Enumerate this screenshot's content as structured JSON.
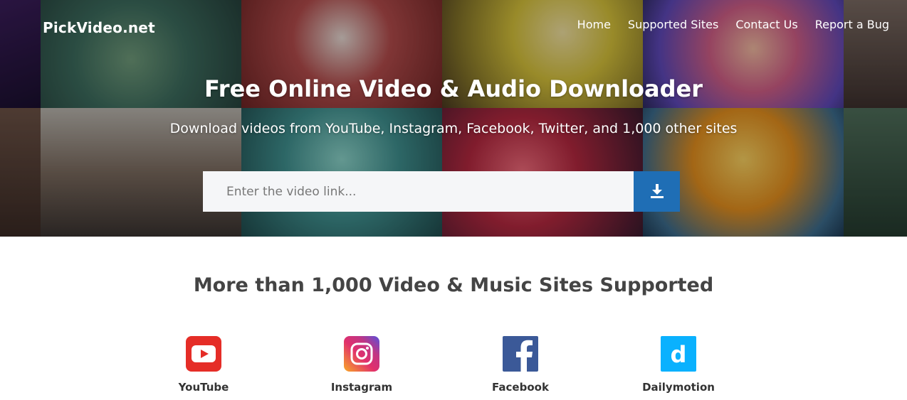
{
  "brand": "PickVideo.net",
  "nav": [
    {
      "label": "Home"
    },
    {
      "label": "Supported Sites"
    },
    {
      "label": "Contact Us"
    },
    {
      "label": "Report a Bug"
    }
  ],
  "hero": {
    "title": "Free Online Video & Audio Downloader",
    "subtitle": "Download videos from YouTube, Instagram, Facebook, Twitter, and 1,000 other sites"
  },
  "search": {
    "placeholder": "Enter the video link...",
    "value": "",
    "button_icon": "download-icon"
  },
  "sites_section": {
    "title": "More than 1,000 Video & Music Sites Supported",
    "sites": [
      {
        "name": "YouTube",
        "icon": "youtube-icon",
        "color": "#e52d27"
      },
      {
        "name": "Instagram",
        "icon": "instagram-icon",
        "color": "#c13584"
      },
      {
        "name": "Facebook",
        "icon": "facebook-icon",
        "color": "#3b5998"
      },
      {
        "name": "Dailymotion",
        "icon": "dailymotion-icon",
        "color": "#0ab1fe"
      }
    ]
  },
  "colors": {
    "accent": "#1f6eb5",
    "search_bg": "#f5f6f8"
  }
}
